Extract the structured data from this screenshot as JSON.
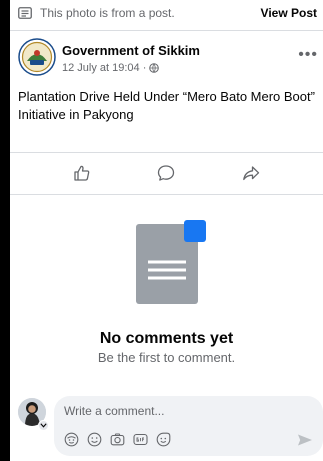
{
  "colors": {
    "accent": "#1877f2",
    "text_primary": "#050505",
    "text_secondary": "#65676b",
    "divider": "#dadde1",
    "composer_bg": "#f0f2f5",
    "doc_gray": "#9aa0a7"
  },
  "notice": {
    "text": "This photo is from a post.",
    "view_post": "View Post",
    "icon": "document-icon"
  },
  "post": {
    "page_name": "Government of Sikkim",
    "timestamp": "12 July at 19:04 ·",
    "privacy_icon": "globe-icon",
    "more_icon": "more-options-icon",
    "text": "Plantation Drive Held Under “Mero Bato Mero Boot” Initiative in Pakyong"
  },
  "actions": {
    "like_icon": "thumbs-up-icon",
    "comment_icon": "comment-icon",
    "share_icon": "share-icon"
  },
  "empty_state": {
    "title": "No comments yet",
    "subtitle": "Be the first to comment."
  },
  "composer": {
    "placeholder": "Write a comment...",
    "tools": [
      "avatar-sticker-icon",
      "emoji-icon",
      "camera-icon",
      "gif-icon",
      "sticker-icon"
    ],
    "send_icon": "send-icon"
  }
}
